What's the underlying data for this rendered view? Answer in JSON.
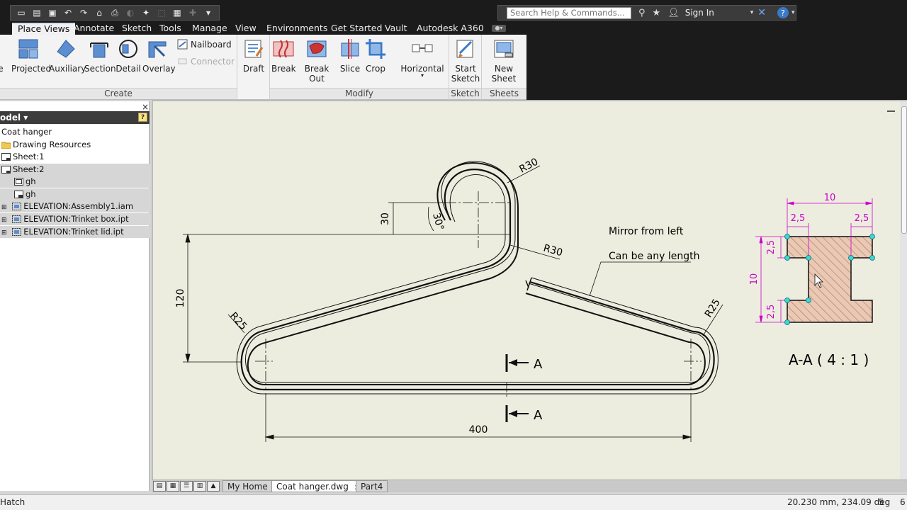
{
  "titlebar": {
    "search_placeholder": "Search Help & Commands...",
    "sign_in": "Sign In",
    "help": "?"
  },
  "ribbon_tabs": [
    "Place Views",
    "Annotate",
    "Sketch",
    "Tools",
    "Manage",
    "View",
    "Environments",
    "Get Started",
    "Vault",
    "Autodesk A360"
  ],
  "ribbon": {
    "create": {
      "group_label": "Create",
      "buttons": [
        "e",
        "Projected",
        "Auxiliary",
        "Section",
        "Detail",
        "Overlay"
      ],
      "nailboard": "Nailboard",
      "connector": "Connector"
    },
    "draft": "Draft",
    "modify": {
      "group_label": "Modify",
      "buttons": [
        "Break",
        "Break Out",
        "Slice",
        "Crop",
        "Horizontal"
      ]
    },
    "sketch": {
      "group_label": "Sketch",
      "button_line1": "Start",
      "button_line2": "Sketch"
    },
    "sheets": {
      "group_label": "Sheets",
      "button": "New Sheet"
    }
  },
  "browser": {
    "header": "odel ▾",
    "help": "?",
    "close": "×",
    "items": [
      {
        "label": "Coat hanger"
      },
      {
        "label": "Drawing Resources"
      },
      {
        "label": "Sheet:1"
      },
      {
        "label": "Sheet:2"
      },
      {
        "label": "gh"
      },
      {
        "label": "gh"
      },
      {
        "label": "ELEVATION:Assembly1.iam"
      },
      {
        "label": "ELEVATION:Trinket box.ipt"
      },
      {
        "label": "ELEVATION:Trinket lid.ipt"
      }
    ]
  },
  "drawing": {
    "dim_30": "30",
    "angle_30": "30°",
    "dim_120": "120",
    "dim_400": "400",
    "r30_top": "R30",
    "r30_bottom": "R30",
    "r25_left": "R25",
    "r25_right": "R25",
    "note_mirror": "Mirror from left",
    "note_length": "Can be any length",
    "section_label_top": "A",
    "section_label_bottom": "A",
    "section_title": "A-A ( 4 : 1 )",
    "section_dims": {
      "width": "10",
      "left_flange": "2,5",
      "right_flange": "2,5",
      "height": "10",
      "top_web": "2,5",
      "bottom_web": "2,5"
    },
    "colors": {
      "line": "#111111",
      "dimension": "#cc00cc",
      "hatch_fill": "#e8c9b5",
      "hatch": "#b55a3c",
      "grip": "#3cd6d6"
    }
  },
  "doc_tabs": [
    "My Home",
    "Coat hanger.dwg",
    "Part4"
  ],
  "doc_tab_close": "×",
  "status": {
    "left": "Hatch",
    "coords": "20.230 mm, 234.09 deg",
    "count": "5",
    "extra": "6"
  }
}
